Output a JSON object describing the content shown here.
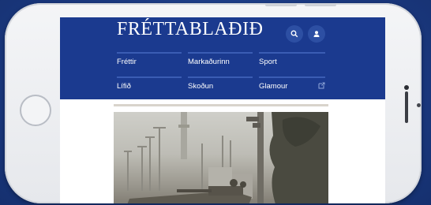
{
  "site": {
    "logo": "FRÉTTABLAÐIÐ"
  },
  "header": {
    "search_icon": "search-icon",
    "user_icon": "user-icon"
  },
  "nav": {
    "items": [
      {
        "label": "Fréttir"
      },
      {
        "label": "Markaðurinn"
      },
      {
        "label": "Sport"
      },
      {
        "label": "Lífið"
      },
      {
        "label": "Skoðun"
      },
      {
        "label": "Glamour",
        "icon": "external-link-icon"
      }
    ]
  },
  "colors": {
    "header_bg": "#1b3a8f",
    "page_bg": "#1f3f8a",
    "phone_body": "#f0f1f3"
  }
}
